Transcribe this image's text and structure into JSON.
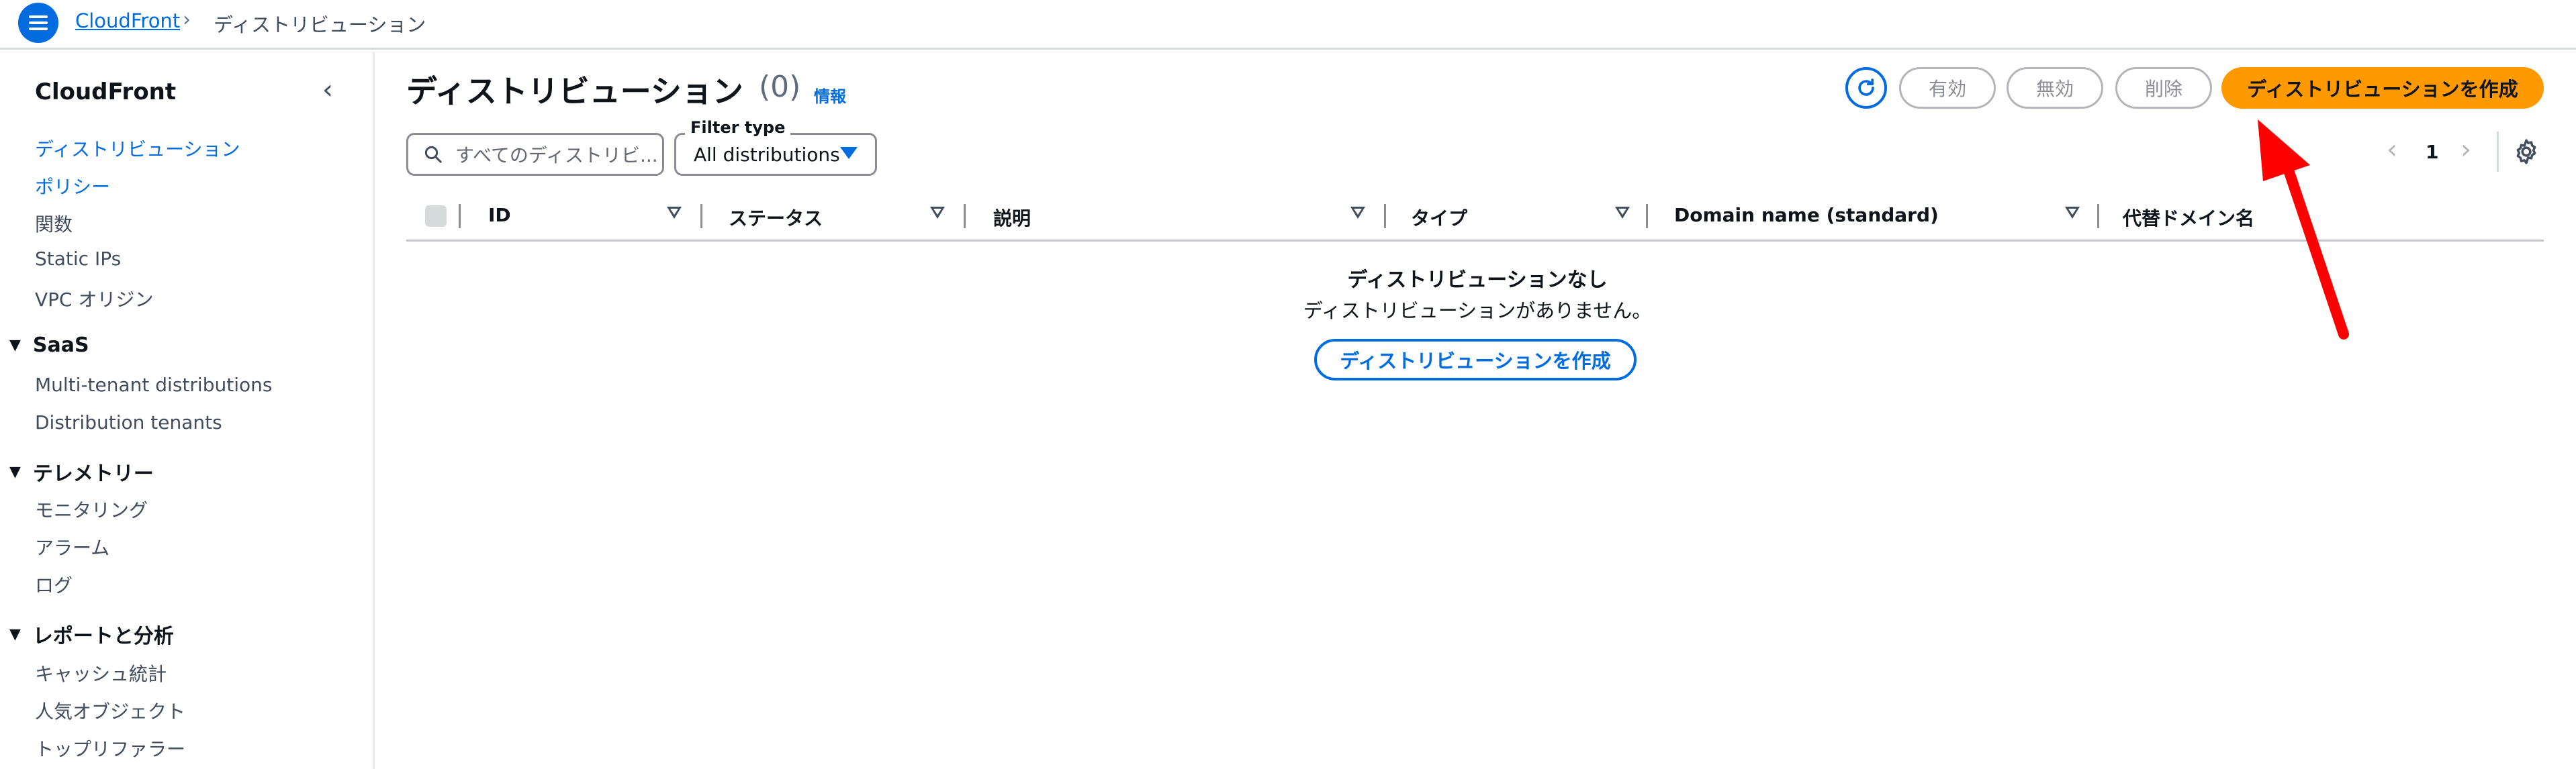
{
  "breadcrumb": {
    "service": "CloudFront",
    "current": "ディストリビューション"
  },
  "sidebar": {
    "title": "CloudFront",
    "items": [
      {
        "label": "ディストリビューション",
        "active": true
      },
      {
        "label": "ポリシー",
        "active": true
      },
      {
        "label": "関数"
      },
      {
        "label": "Static IPs"
      },
      {
        "label": "VPC オリジン"
      }
    ],
    "sections": [
      {
        "title": "SaaS",
        "items": [
          "Multi-tenant distributions",
          "Distribution tenants"
        ]
      },
      {
        "title": "テレメトリー",
        "items": [
          "モニタリング",
          "アラーム",
          "ログ"
        ]
      },
      {
        "title": "レポートと分析",
        "items": [
          "キャッシュ統計",
          "人気オブジェクト",
          "トップリファラー"
        ]
      }
    ]
  },
  "header": {
    "title": "ディストリビューション",
    "count": "(0)",
    "info": "情報"
  },
  "actions": {
    "enable": "有効",
    "disable": "無効",
    "delete": "削除",
    "create": "ディストリビューションを作成"
  },
  "filters": {
    "search_placeholder": "すべてのディストリビ...",
    "filter_type_label": "Filter type",
    "filter_type_value": "All distributions"
  },
  "pagination": {
    "current_page": "1"
  },
  "table": {
    "columns": [
      "ID",
      "ステータス",
      "説明",
      "タイプ",
      "Domain name (standard)",
      "代替ドメイン名"
    ]
  },
  "empty_state": {
    "title": "ディストリビューションなし",
    "description": "ディストリビューションがありません。",
    "button": "ディストリビューションを作成"
  },
  "colors": {
    "primary_blue": "#006ce0",
    "primary_orange": "#ff9900",
    "annotation_red": "#ff0000"
  }
}
